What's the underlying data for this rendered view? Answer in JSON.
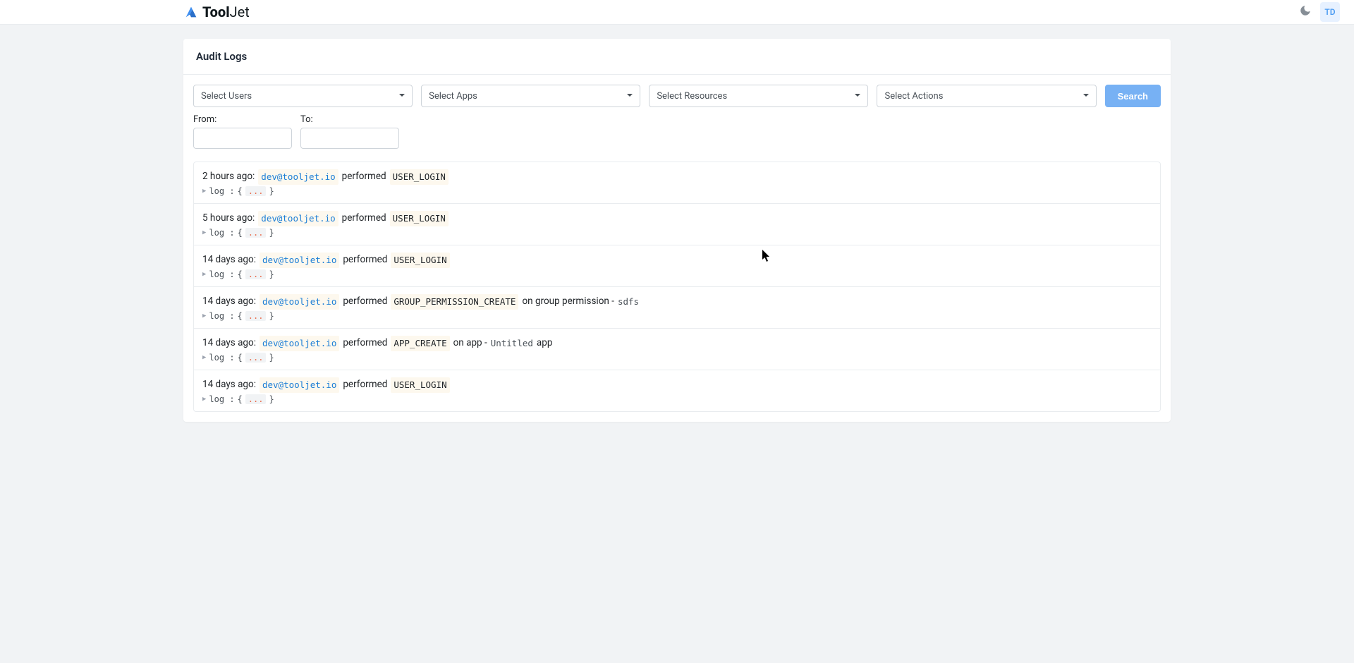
{
  "header": {
    "brand_bold": "Tool",
    "brand_light": "Jet",
    "avatar_initials": "TD"
  },
  "page": {
    "title": "Audit Logs",
    "filters": {
      "users_placeholder": "Select Users",
      "apps_placeholder": "Select Apps",
      "resources_placeholder": "Select Resources",
      "actions_placeholder": "Select Actions",
      "search_button": "Search",
      "from_label": "From:",
      "to_label": "To:",
      "from_value": "",
      "to_value": ""
    }
  },
  "log_common": {
    "performed_word": "performed",
    "log_label": "log :",
    "brace_open": "{",
    "brace_close": "}",
    "ellipsis": "..."
  },
  "logs": [
    {
      "time": "2 hours ago:",
      "user": "dev@tooljet.io",
      "action": "USER_LOGIN",
      "target_prefix": "",
      "target_name": "",
      "target_suffix": ""
    },
    {
      "time": "5 hours ago:",
      "user": "dev@tooljet.io",
      "action": "USER_LOGIN",
      "target_prefix": "",
      "target_name": "",
      "target_suffix": ""
    },
    {
      "time": "14 days ago:",
      "user": "dev@tooljet.io",
      "action": "USER_LOGIN",
      "target_prefix": "",
      "target_name": "",
      "target_suffix": ""
    },
    {
      "time": "14 days ago:",
      "user": "dev@tooljet.io",
      "action": "GROUP_PERMISSION_CREATE",
      "target_prefix": "on group permission -",
      "target_name": "sdfs",
      "target_suffix": ""
    },
    {
      "time": "14 days ago:",
      "user": "dev@tooljet.io",
      "action": "APP_CREATE",
      "target_prefix": "on app -",
      "target_name": "Untitled",
      "target_suffix": "app"
    },
    {
      "time": "14 days ago:",
      "user": "dev@tooljet.io",
      "action": "USER_LOGIN",
      "target_prefix": "",
      "target_name": "",
      "target_suffix": ""
    }
  ]
}
